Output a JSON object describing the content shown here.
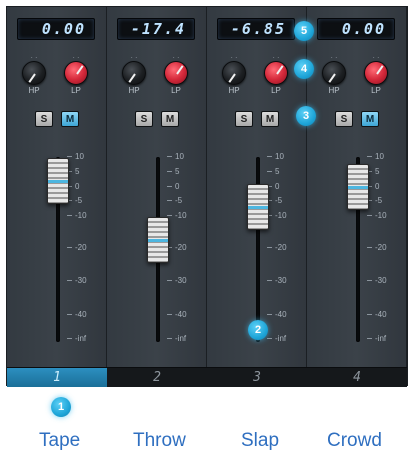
{
  "channels": [
    {
      "id": "1",
      "value": "0.00",
      "hp": "HP",
      "lp": "LP",
      "solo": "S",
      "mute": "M",
      "mute_on": true,
      "selected": true,
      "number": "1",
      "caption": "Tape",
      "fader_level_db": 2
    },
    {
      "id": "2",
      "value": "-17.4",
      "hp": "HP",
      "lp": "LP",
      "solo": "S",
      "mute": "M",
      "mute_on": false,
      "selected": false,
      "number": "2",
      "caption": "Throw",
      "fader_level_db": -17.4
    },
    {
      "id": "3",
      "value": "-6.85",
      "hp": "HP",
      "lp": "LP",
      "solo": "S",
      "mute": "M",
      "mute_on": false,
      "selected": false,
      "number": "3",
      "caption": "Slap",
      "fader_level_db": -6.85
    },
    {
      "id": "4",
      "value": "0.00",
      "hp": "HP",
      "lp": "LP",
      "solo": "S",
      "mute": "M",
      "mute_on": true,
      "selected": false,
      "number": "4",
      "caption": "Crowd",
      "fader_level_db": 0
    }
  ],
  "scale_labels": [
    "10",
    "5",
    "0",
    "-5",
    "-10",
    "-20",
    "-30",
    "-40",
    "-inf"
  ],
  "callouts": [
    "1",
    "2",
    "3",
    "4",
    "5"
  ],
  "colors": {
    "accent": "#2c8fc0",
    "caption": "#2f6fc0",
    "lp_knob": "#d62a3c",
    "mute_on": "#3ea6d6"
  },
  "icons": {
    "hp_knob": "hp-knob-icon",
    "lp_knob": "lp-knob-icon"
  }
}
